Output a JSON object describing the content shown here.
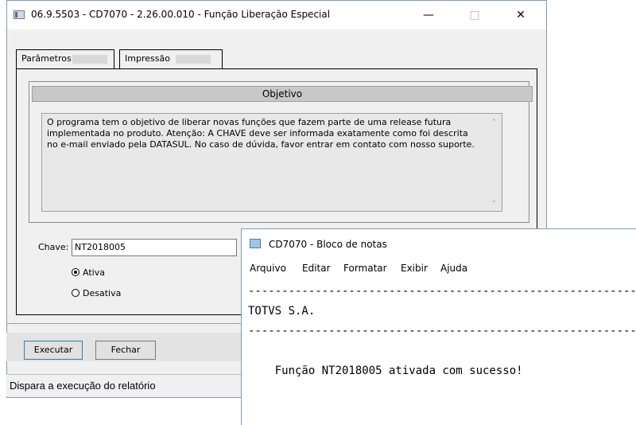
{
  "window": {
    "title": "06.9.5503 - CD7070 - 2.26.00.010 - Função Liberação Especial",
    "minimize": "—",
    "maximize": "□",
    "close": "✕"
  },
  "tabs": [
    {
      "label": "Parâmetros"
    },
    {
      "label": "Impressão"
    }
  ],
  "objective": {
    "header": "Objetivo",
    "text": "O programa tem o objetivo de liberar novas funções que fazem parte de uma release futura implementada no produto. Atenção: A CHAVE deve ser informada exatamente como foi descrita no e-mail enviado pela DATASUL. No caso de dúvida, favor entrar em contato com nosso suporte."
  },
  "form": {
    "chave_label": "Chave:",
    "chave_value": "NT2018005",
    "radio_ativa": "Ativa",
    "radio_desativa": "Desativa",
    "selected": "Ativa"
  },
  "buttons": {
    "executar": "Executar",
    "fechar": "Fechar"
  },
  "status": {
    "text": "Dispara a execução do relatório"
  },
  "notepad": {
    "title": "CD7070 - Bloco de notas",
    "menu": [
      "Arquivo",
      "Editar",
      "Formatar",
      "Exibir",
      "Ajuda"
    ],
    "lines": [
      "-------------------------------------------------------------",
      "TOTVS S.A.",
      "-------------------------------------------------------------",
      "",
      "    Função NT2018005 ativada com sucesso!"
    ]
  },
  "icons": {
    "scroll_up": "⌃",
    "scroll_down": "⌄"
  }
}
